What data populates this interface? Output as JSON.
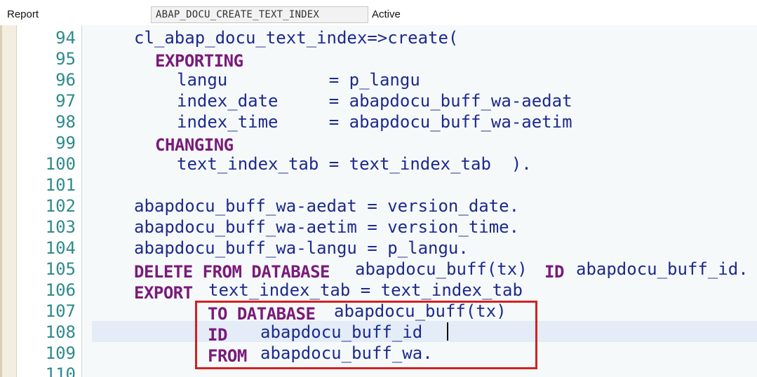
{
  "header": {
    "object_type": "Report",
    "object_name": "ABAP_DOCU_CREATE_TEXT_INDEX",
    "status": "Active"
  },
  "editor": {
    "line_numbers": [
      "94",
      "95",
      "96",
      "97",
      "98",
      "99",
      "100",
      "101",
      "102",
      "103",
      "104",
      "105",
      "106",
      "107",
      "108",
      "109",
      "110"
    ],
    "code": {
      "l94": "cl_abap_docu_text_index=>create(",
      "l95_kw": "EXPORTING",
      "l96": "langu          = p_langu",
      "l97": "index_date     = abapdocu_buff_wa-aedat",
      "l98": "index_time     = abapdocu_buff_wa-aetim",
      "l99_kw": "CHANGING",
      "l100": "text_index_tab = text_index_tab  ).",
      "l102": "abapdocu_buff_wa-aedat = version_date.",
      "l103": "abapdocu_buff_wa-aetim = version_time.",
      "l104": "abapdocu_buff_wa-langu = p_langu.",
      "l105_kw": "DELETE FROM DATABASE",
      "l105_tx1": "abapdocu_buff(tx)",
      "l105_kw2": "ID",
      "l105_tx2": "abapdocu_buff_id.",
      "l106_kw": "EXPORT",
      "l106_tx": "text_index_tab = text_index_tab",
      "l107_kw": "TO DATABASE",
      "l107_tx": "abapdocu_buff(tx)",
      "l108_kw": "ID",
      "l108_tx": "abapdocu_buff_id",
      "l109_kw": "FROM",
      "l109_tx": "abapdocu_buff_wa."
    }
  },
  "colors": {
    "keyword": "#7a1a7a",
    "identifier": "#1c2a8c",
    "line_number": "#2e8b8a",
    "highlight_border": "#d42020"
  }
}
